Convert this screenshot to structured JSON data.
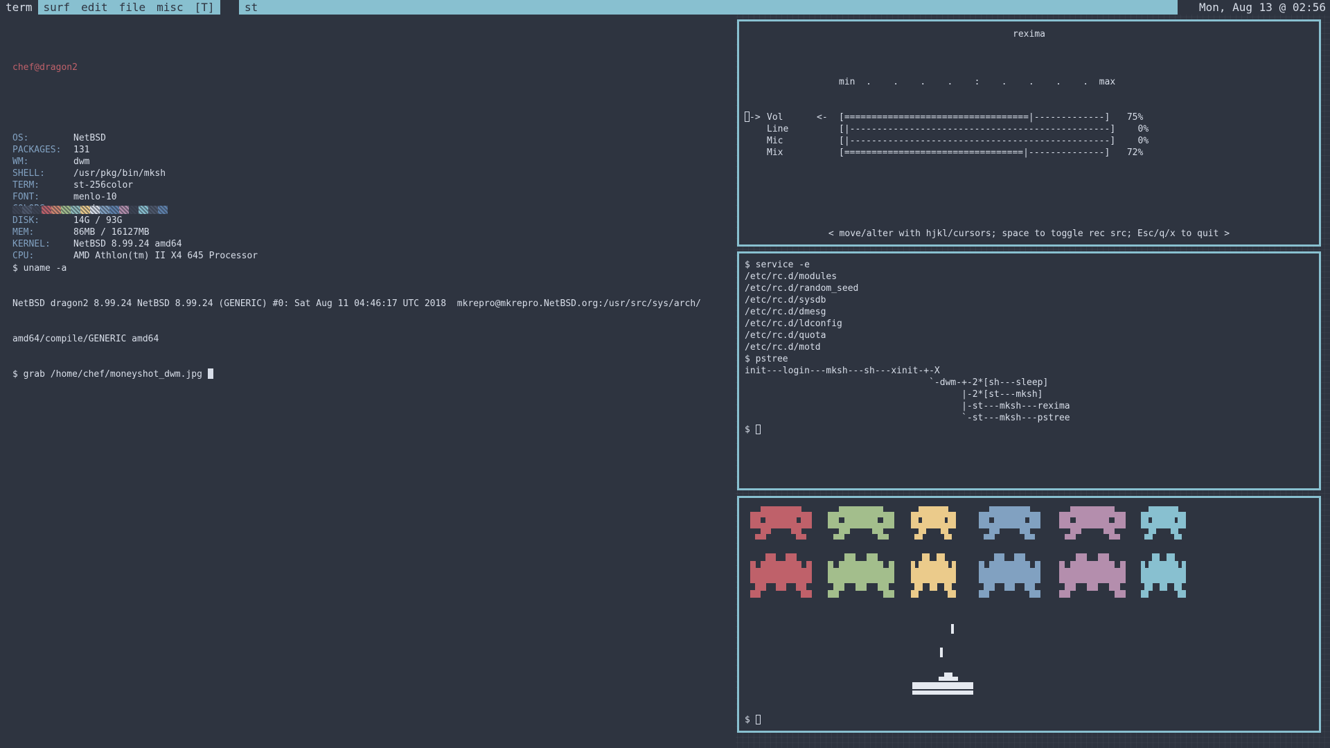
{
  "bar": {
    "tags": [
      "term",
      "surf",
      "edit",
      "file",
      "misc"
    ],
    "selected_tag": "term",
    "layout_symbol": "[T]",
    "window_title": "st",
    "status": "Mon, Aug 13 @ 02:56"
  },
  "left_terminal": {
    "user_host": "chef@dragon2",
    "sysinfo": [
      {
        "key": "OS:",
        "value": "NetBSD"
      },
      {
        "key": "PACKAGES:",
        "value": "131"
      },
      {
        "key": "WM:",
        "value": "dwm"
      },
      {
        "key": "SHELL:",
        "value": "/usr/pkg/bin/mksh"
      },
      {
        "key": "TERM:",
        "value": "st-256color"
      },
      {
        "key": "FONT:",
        "value": "menlo-10"
      },
      {
        "key": "COLORS:",
        "value": "nord"
      },
      {
        "key": "DISK:",
        "value": "14G / 93G"
      },
      {
        "key": "MEM:",
        "value": "86MB / 16127MB"
      },
      {
        "key": "KERNEL:",
        "value": "NetBSD 8.99.24 amd64"
      },
      {
        "key": "CPU:",
        "value": "AMD Athlon(tm) II X4 645 Processor"
      }
    ],
    "palette": [
      "#3b4252",
      "#4c566a",
      "#3b4252",
      "#bf616a",
      "#d08770",
      "#a3be8c",
      "#8fbcbb",
      "#ebcb8b",
      "#d8dee9",
      "#81a1c1",
      "#5e81ac",
      "#b48ead",
      "#3b4252",
      "#88c0d0",
      "#4c566a",
      "#5e81ac"
    ],
    "cmd1": "$ uname -a",
    "out1": "NetBSD dragon2 8.99.24 NetBSD 8.99.24 (GENERIC) #0: Sat Aug 11 04:46:17 UTC 2018  mkrepro@mkrepro.NetBSD.org:/usr/src/sys/arch/",
    "out2": "amd64/compile/GENERIC amd64",
    "cmd2": "$ grab /home/chef/moneyshot_dwm.jpg "
  },
  "rexima": {
    "title": "rexima",
    "scale_header": "min  .    .    .    .    :    .    .    .    .  max",
    "channels": [
      {
        "name": "Vol",
        "selected": true,
        "rec": "<-",
        "bar": "[==================================|-------------]",
        "level": "75%",
        "fraction": 0.75
      },
      {
        "name": "Line",
        "selected": false,
        "rec": "",
        "bar": "[|------------------------------------------------]",
        "level": "0%",
        "fraction": 0
      },
      {
        "name": "Mic",
        "selected": false,
        "rec": "",
        "bar": "[|------------------------------------------------]",
        "level": "0%",
        "fraction": 0
      },
      {
        "name": "Mix",
        "selected": false,
        "rec": "",
        "bar": "[=================================|--------------]",
        "level": "72%",
        "fraction": 0.72
      }
    ],
    "help": "< move/alter with hjkl/cursors; space to toggle rec src; Esc/q/x to quit >"
  },
  "services_terminal": {
    "lines": [
      "$ service -e",
      "/etc/rc.d/modules",
      "/etc/rc.d/random_seed",
      "/etc/rc.d/sysdb",
      "/etc/rc.d/dmesg",
      "/etc/rc.d/ldconfig",
      "/etc/rc.d/quota",
      "/etc/rc.d/motd",
      "$ pstree",
      "init---login---mksh---sh---xinit-+-X",
      "                                  `-dwm-+-2*[sh---sleep]",
      "                                        |-2*[st---mksh]",
      "                                        |-st---mksh---rexima",
      "                                        `-st---mksh---pstree"
    ],
    "prompt": "$ "
  },
  "invaders_terminal": {
    "colors": [
      "#bf616a",
      "#a3be8c",
      "#ebcb8b",
      "#81a1c1",
      "#b48ead",
      "#88c0d0"
    ],
    "ship_color": "#e5e9f0",
    "prompt": "$ "
  }
}
